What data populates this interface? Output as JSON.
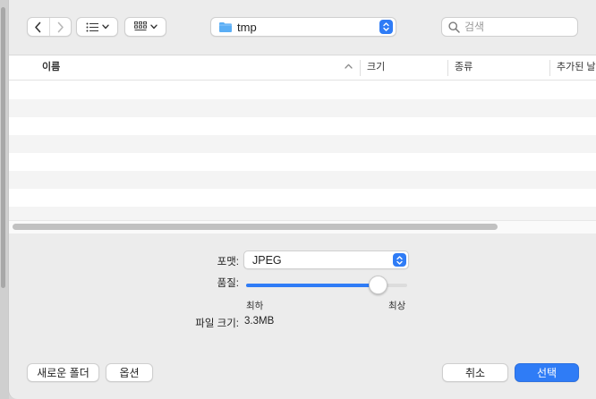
{
  "toolbar": {
    "back_icon": "chevron-left",
    "forward_icon": "chevron-right",
    "list_view_icon": "list-view",
    "grid_view_icon": "icon-grid",
    "location": {
      "folder_name": "tmp",
      "folder_icon_color": "#5aaef5"
    },
    "search": {
      "placeholder": "검색",
      "value": ""
    }
  },
  "file_list": {
    "columns": [
      {
        "label": "이름",
        "sorted": "ascending"
      },
      {
        "label": "크기"
      },
      {
        "label": "종류"
      },
      {
        "label": "추가된 날짜"
      }
    ],
    "rows": []
  },
  "accessory": {
    "format_label": "포맷:",
    "format_value": "JPEG",
    "quality_label": "품질:",
    "quality_level": 0.82,
    "quality_min_label": "최하",
    "quality_max_label": "최상",
    "file_size_label": "파일 크기:",
    "file_size_value": "3.3MB"
  },
  "buttons": {
    "new_folder": "새로운 폴더",
    "options": "옵션",
    "cancel": "취소",
    "choose": "선택"
  },
  "colors": {
    "accent": "#2f7cf6",
    "sheet_background": "#ececec",
    "row_stripe": "#f4f4f4"
  }
}
